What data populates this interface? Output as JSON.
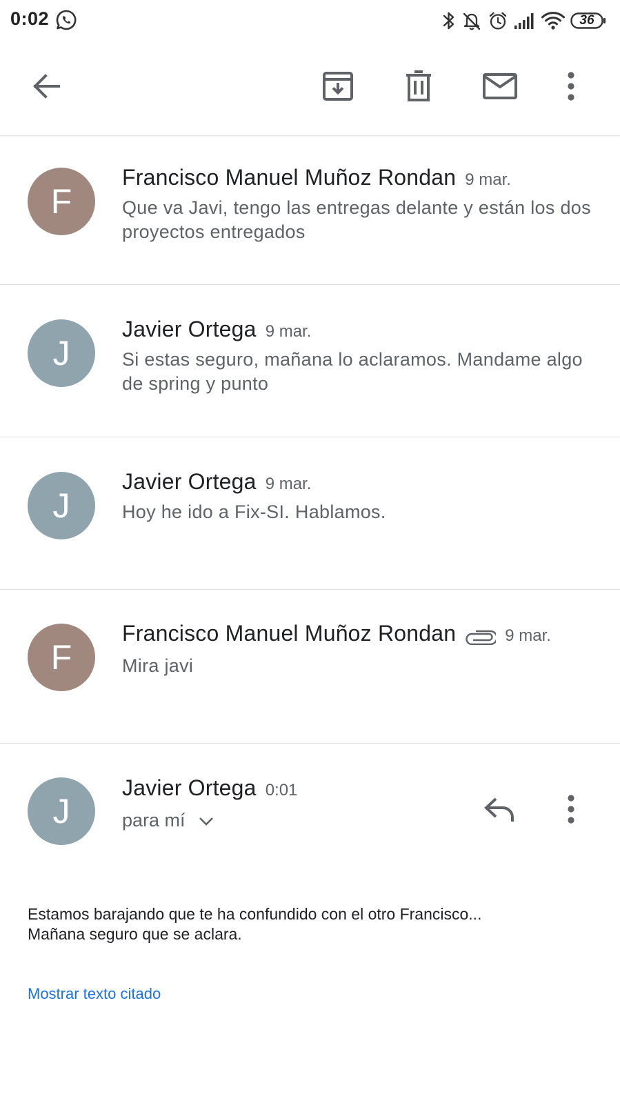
{
  "status_bar": {
    "time": "0:02",
    "battery": "36",
    "icons": [
      "whatsapp-icon",
      "bluetooth-icon",
      "notifications-off-icon",
      "alarm-icon",
      "signal-icon",
      "wifi-icon",
      "battery-icon"
    ]
  },
  "toolbar": {
    "icons": [
      "back-arrow-icon",
      "archive-icon",
      "delete-icon",
      "mark-unread-icon",
      "more-vert-icon"
    ]
  },
  "messages": [
    {
      "avatar_letter": "F",
      "avatar_color": "#A1887F",
      "sender": "Francisco Manuel Muñoz Rondan",
      "date": "9 mar.",
      "snippet": "Que va Javi, tengo las entregas delante y están los dos proyectos entregados"
    },
    {
      "avatar_letter": "J",
      "avatar_color": "#90A4AE",
      "sender": "Javier Ortega",
      "date": "9 mar.",
      "snippet": "Si estas seguro, mañana lo aclaramos. Mandame algo de spring y punto"
    },
    {
      "avatar_letter": "J",
      "avatar_color": "#90A4AE",
      "sender": "Javier Ortega",
      "date": "9 mar.",
      "snippet": "Hoy he ido a Fix-SI. Hablamos."
    },
    {
      "avatar_letter": "F",
      "avatar_color": "#A1887F",
      "sender": "Francisco Manuel Muñoz Rondan",
      "date": "9 mar.",
      "has_attachment": true,
      "snippet": "Mira javi"
    }
  ],
  "expanded_message": {
    "avatar_letter": "J",
    "avatar_color": "#90A4AE",
    "sender": "Javier Ortega",
    "time": "0:01",
    "recipient": "para mí",
    "body_line1": "Estamos barajando que te ha confundido con el otro Francisco...",
    "body_line2": "Mañana seguro que se aclara.",
    "quoted_link": "Mostrar texto citado"
  },
  "colors": {
    "link": "#1a73e8",
    "icon": "#5f6368",
    "secondary_text": "#5f6368"
  }
}
